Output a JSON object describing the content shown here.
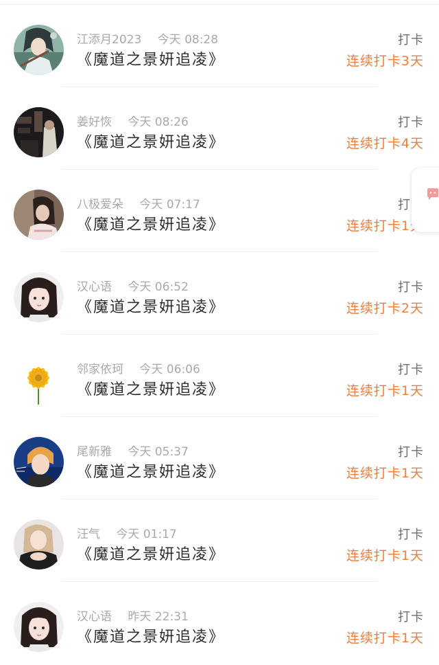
{
  "checkins": [
    {
      "name": "江添月2023",
      "time": "今天 08:28",
      "title": "《魔道之景妍追凌》",
      "action": "打卡",
      "streak": "连续打卡3天",
      "avatar": "anime-avatar"
    },
    {
      "name": "姜好恢",
      "time": "今天 08:26",
      "title": "《魔道之景妍追凌》",
      "action": "打卡",
      "streak": "连续打卡4天",
      "avatar": "dark-scene-avatar"
    },
    {
      "name": "八极爱朵",
      "time": "今天 07:17",
      "title": "《魔道之景妍追凌》",
      "action": "打卡",
      "streak": "连续打卡1天",
      "avatar": "girl-avatar"
    },
    {
      "name": "汉心语",
      "time": "今天 06:52",
      "title": "《魔道之景妍追凌》",
      "action": "打卡",
      "streak": "连续打卡2天",
      "avatar": "doll-avatar"
    },
    {
      "name": "邻家依珂",
      "time": "今天 06:06",
      "title": "《魔道之景妍追凌》",
      "action": "打卡",
      "streak": "连续打卡1天",
      "avatar": "sunflower-avatar"
    },
    {
      "name": "尾新雅",
      "time": "今天 05:37",
      "title": "《魔道之景妍追凌》",
      "action": "打卡",
      "streak": "连续打卡1天",
      "avatar": "blond-boy-avatar"
    },
    {
      "name": "汪气",
      "time": "今天 01:17",
      "title": "《魔道之景妍追凌》",
      "action": "打卡",
      "streak": "连续打卡1天",
      "avatar": "woman-avatar"
    },
    {
      "name": "汉心语",
      "time": "昨天 22:31",
      "title": "《魔道之景妍追凌》",
      "action": "打卡",
      "streak": "连续打卡1天",
      "avatar": "doll-avatar"
    }
  ],
  "colors": {
    "streak": "#f07d3a",
    "meta": "#a9a9a9",
    "title": "#2d2d2d",
    "action": "#6f6f6f"
  },
  "float_tab_icon": "chat-bubble-icon"
}
